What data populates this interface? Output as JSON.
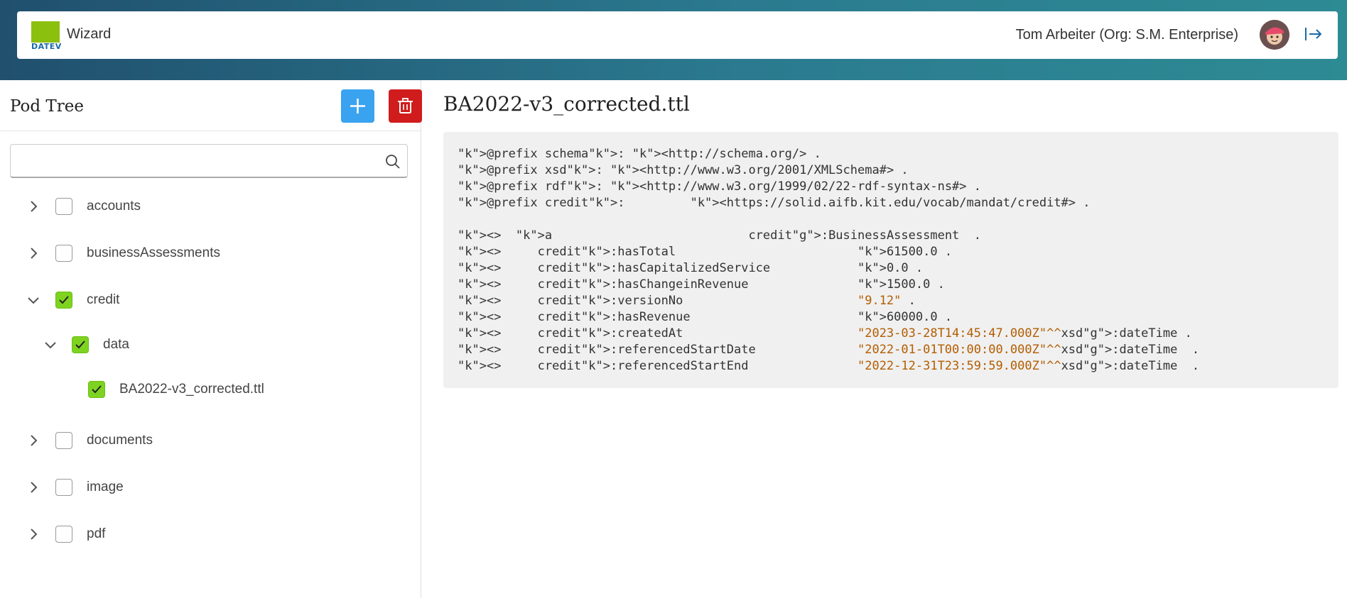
{
  "header": {
    "app_title": "Wizard",
    "logo_text": "DATEV",
    "user_name": "Tom Arbeiter (Org: S.M. Enterprise)"
  },
  "sidebar": {
    "title": "Pod Tree",
    "search_placeholder": "",
    "items": [
      {
        "label": "accounts",
        "expanded": false,
        "checked": false
      },
      {
        "label": "businessAssessments",
        "expanded": false,
        "checked": false
      },
      {
        "label": "credit",
        "expanded": true,
        "checked": true
      },
      {
        "label": "data",
        "expanded": true,
        "checked": true
      },
      {
        "label": "BA2022-v3_corrected.ttl",
        "checked": true
      },
      {
        "label": "documents",
        "expanded": false,
        "checked": false
      },
      {
        "label": "image",
        "expanded": false,
        "checked": false
      },
      {
        "label": "pdf",
        "expanded": false,
        "checked": false
      }
    ]
  },
  "main": {
    "file_title": "BA2022-v3_corrected.ttl",
    "code_lines": [
      "@prefix schema: <http://schema.org/> .",
      "@prefix xsd: <http://www.w3.org/2001/XMLSchema#> .",
      "@prefix rdf: <http://www.w3.org/1999/02/22-rdf-syntax-ns#> .",
      "@prefix credit:         <https://solid.aifb.kit.edu/vocab/mandat/credit#> .",
      "",
      "<>  a                           credit:BusinessAssessment  .",
      "<>     credit:hasTotal                         61500.0 .",
      "<>     credit:hasCapitalizedService            0.0 .",
      "<>     credit:hasChangeinRevenue               1500.0 .",
      "<>     credit:versionNo                        \"9.12\" .",
      "<>     credit:hasRevenue                       60000.0 .",
      "<>     credit:createdAt                        \"2023-03-28T14:45:47.000Z\"^^xsd:dateTime .",
      "<>     credit:referencedStartDate              \"2022-01-01T00:00:00.000Z\"^^xsd:dateTime  .",
      "<>     credit:referencedStartEnd               \"2022-12-31T23:59:59.000Z\"^^xsd:dateTime  ."
    ]
  },
  "colors": {
    "accent_blue": "#3aa3f0",
    "delete_red": "#d01c1c",
    "check_green": "#7ed321"
  }
}
